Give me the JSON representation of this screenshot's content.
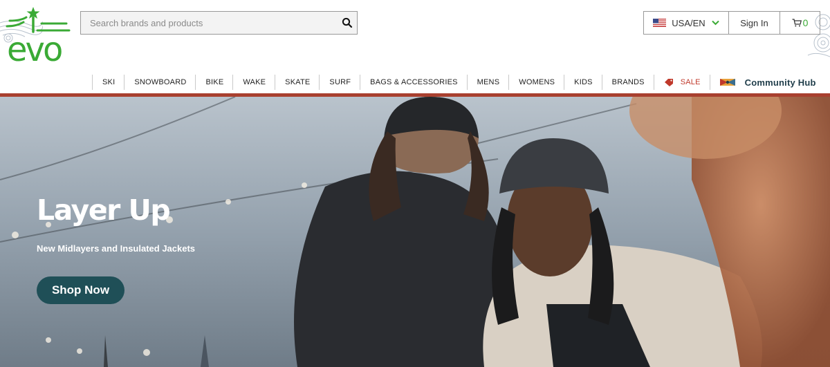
{
  "brand": {
    "logo_text": "evo",
    "color": "#3aaa35"
  },
  "search": {
    "placeholder": "Search brands and products",
    "value": "",
    "icon": "search-icon"
  },
  "utility": {
    "locale_label": "USA/EN",
    "flag_icon": "us-flag-icon",
    "signin_label": "Sign In",
    "cart_icon": "cart-icon",
    "cart_count": "0"
  },
  "nav": {
    "items": [
      "SKI",
      "SNOWBOARD",
      "BIKE",
      "WAKE",
      "SKATE",
      "SURF",
      "BAGS & ACCESSORIES",
      "MENS",
      "WOMENS",
      "KIDS",
      "BRANDS"
    ],
    "sale_label": "SALE",
    "sale_color": "#c0392b",
    "hub_label": "Community Hub",
    "hub_color": "#1f3d4a"
  },
  "accent_bar_color": "#a8402f",
  "hero": {
    "title": "Layer Up",
    "subtitle": "New Midlayers and Insulated Jackets",
    "cta_label": "Shop Now",
    "cta_color": "#1f4f57"
  }
}
